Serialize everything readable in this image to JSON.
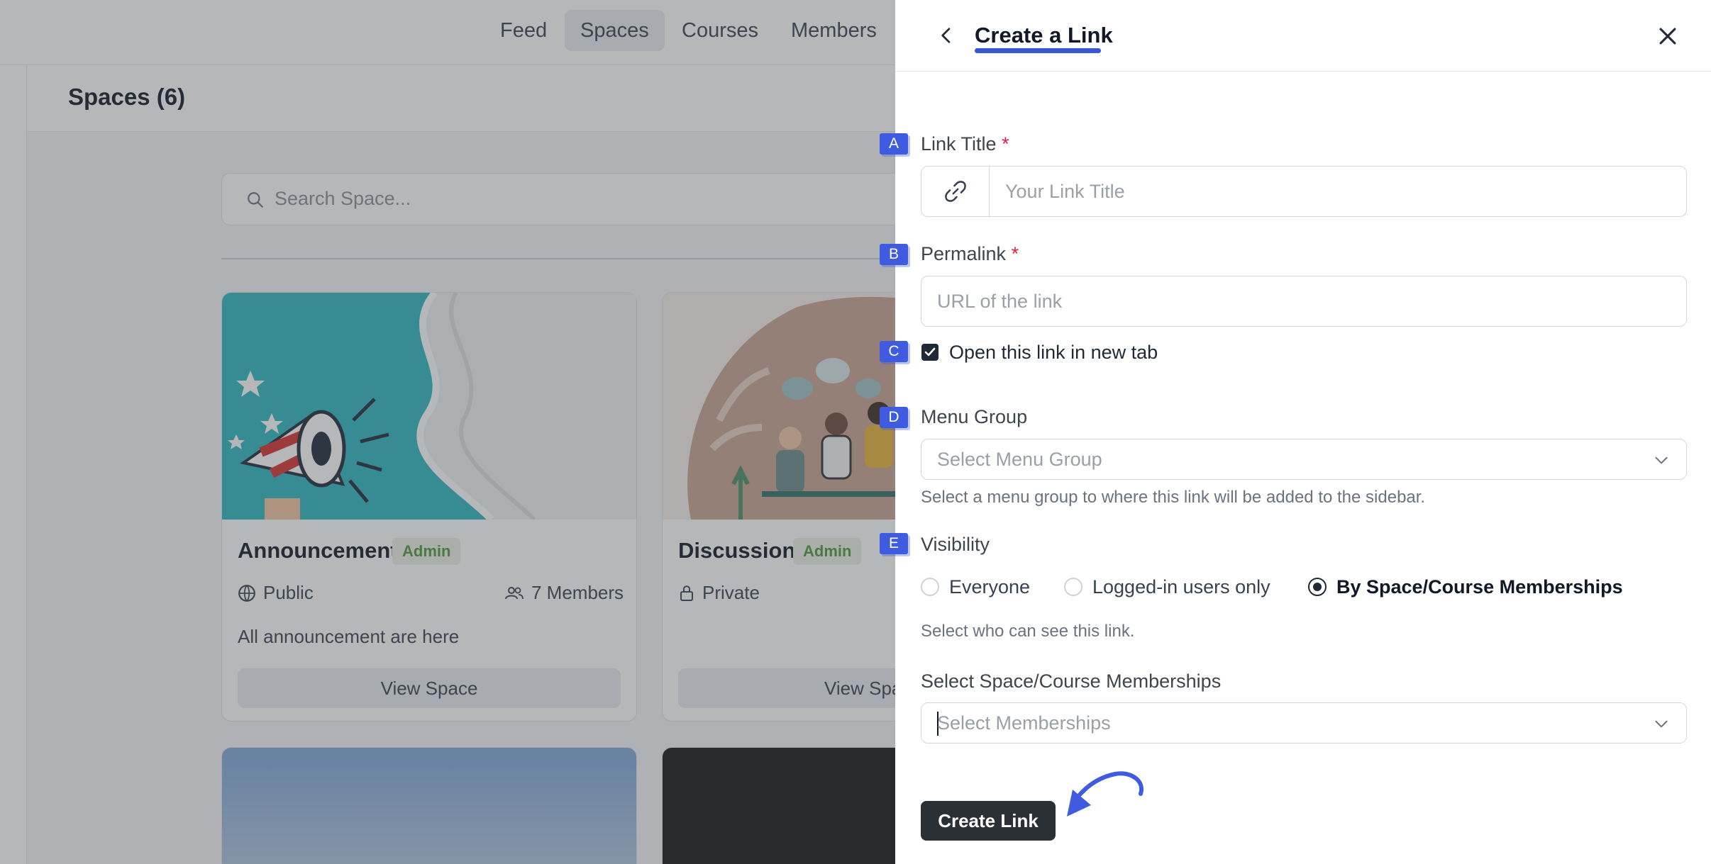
{
  "nav": {
    "items": [
      "Feed",
      "Spaces",
      "Courses",
      "Members"
    ],
    "active": "Spaces"
  },
  "page": {
    "title": "Spaces (6)"
  },
  "search": {
    "placeholder": "Search Space..."
  },
  "cards": [
    {
      "title": "Announcement",
      "badge": "Admin",
      "privacy": "Public",
      "members": "7 Members",
      "description": "All announcement are here",
      "button": "View Space"
    },
    {
      "title": "Discussion",
      "badge": "Admin",
      "privacy": "Private",
      "button": "View Spa"
    }
  ],
  "drawer": {
    "title": "Create a Link",
    "link_title": {
      "marker": "A",
      "label": "Link Title",
      "required": "*",
      "placeholder": "Your Link Title"
    },
    "permalink": {
      "marker": "B",
      "label": "Permalink",
      "required": "*",
      "placeholder": "URL of the link"
    },
    "new_tab": {
      "marker": "C",
      "label": "Open this link in new tab",
      "checked": true
    },
    "menu_group": {
      "marker": "D",
      "label": "Menu Group",
      "placeholder": "Select Menu Group",
      "help": "Select a menu group to where this link will be added to the sidebar."
    },
    "visibility": {
      "marker": "E",
      "label": "Visibility",
      "options": [
        "Everyone",
        "Logged-in users only",
        "By Space/Course Memberships"
      ],
      "selected": "By Space/Course Memberships",
      "help": "Select who can see this link."
    },
    "memberships": {
      "label": "Select Space/Course Memberships",
      "placeholder": "Select Memberships"
    },
    "submit": "Create Link"
  },
  "colors": {
    "accent": "#3f5be0",
    "primary_button": "#2b2f36",
    "badge_text": "#4d9a3a",
    "required": "#e11d48"
  }
}
